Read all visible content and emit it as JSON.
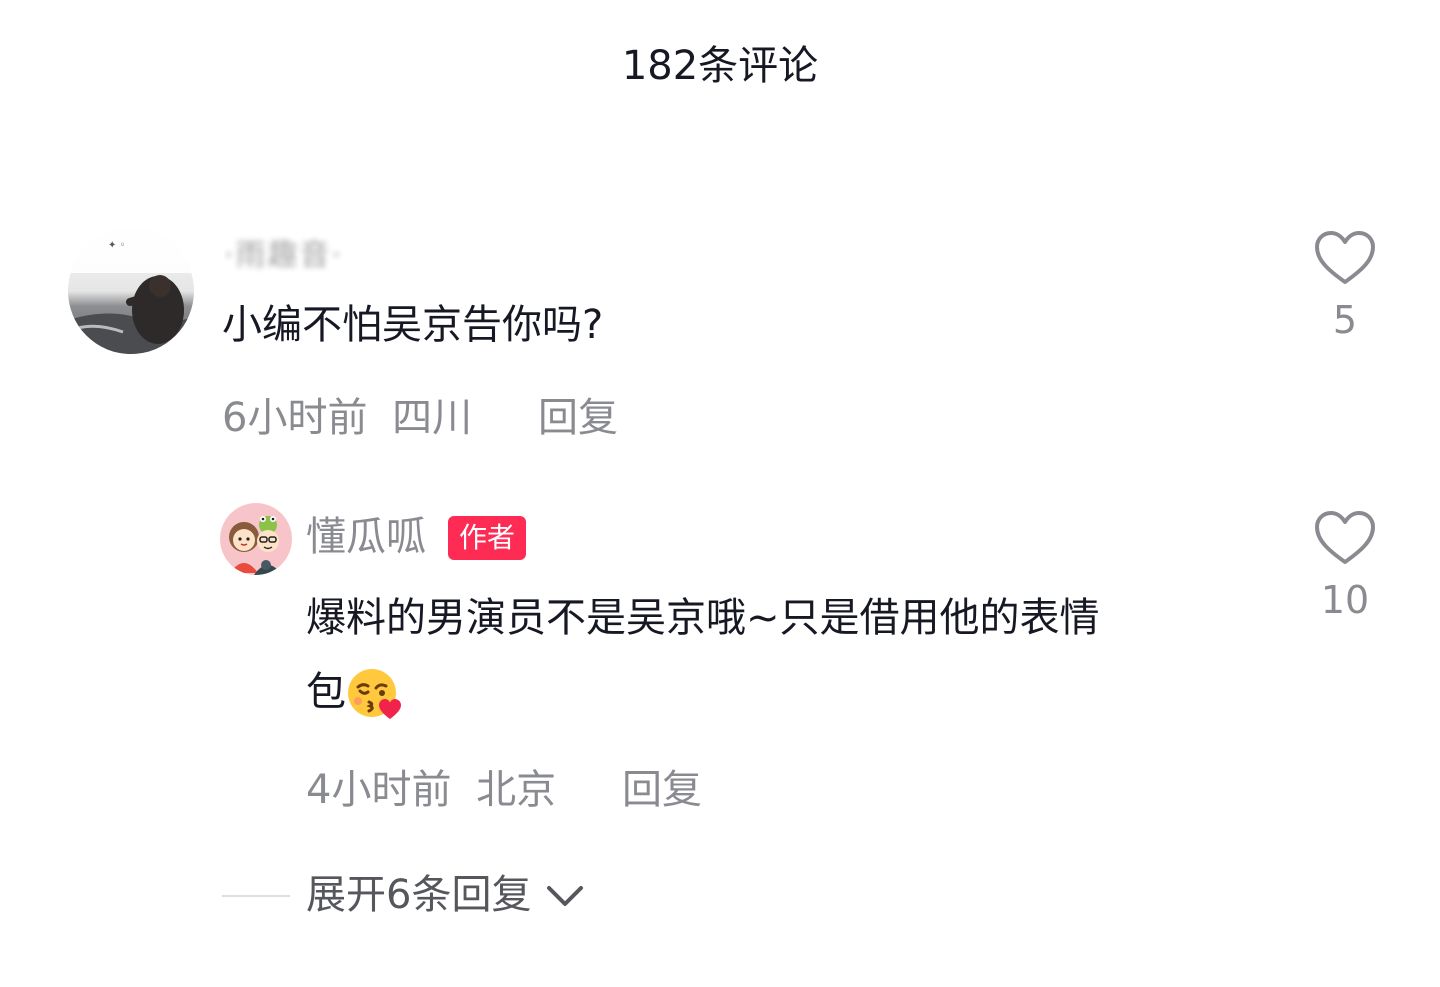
{
  "header": {
    "title": "182条评论"
  },
  "comments": [
    {
      "username": "·雨趣音·",
      "text": "小编不怕吴京告你吗?",
      "time": "6小时前",
      "location": "四川",
      "reply_label": "回复",
      "likes": "5",
      "avatar_icon": "photo-avatar"
    }
  ],
  "reply": {
    "username": "懂瓜呱",
    "badge": "作者",
    "text_line1": "爆料的男演员不是吴京哦~只是借用他的表情",
    "text_line2": "包",
    "emoji": "kissing-face-with-heart-emoji",
    "time": "4小时前",
    "location": "北京",
    "reply_label": "回复",
    "likes": "10",
    "avatar_icon": "cartoon-couple-avatar"
  },
  "expand": {
    "label": "展开6条回复",
    "icon": "chevron-down-icon"
  },
  "colors": {
    "accent": "#fe2c55",
    "secondary_text": "#8a8b91",
    "primary_text": "#161823"
  }
}
